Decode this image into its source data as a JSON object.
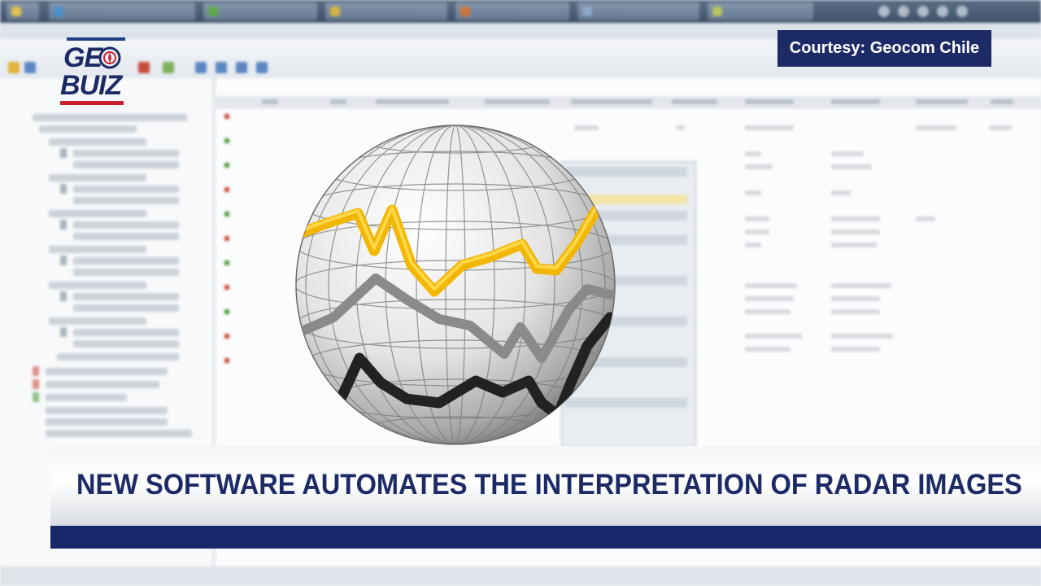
{
  "logo": {
    "line1": "GE",
    "line2": "BUIZ"
  },
  "courtesy": {
    "text": "Courtesy: Geocom Chile"
  },
  "headline": {
    "text": "NEW SOFTWARE AUTOMATES THE INTERPRETATION OF RADAR IMAGES"
  },
  "colors": {
    "brand_navy": "#1c2a66",
    "brand_red": "#c8202d",
    "globe_line_yellow": "#f2b705",
    "globe_line_gray": "#8a8a8a",
    "globe_line_black": "#222222"
  },
  "icons": {
    "globe": "globe-chart-icon",
    "compass": "compass-icon"
  }
}
